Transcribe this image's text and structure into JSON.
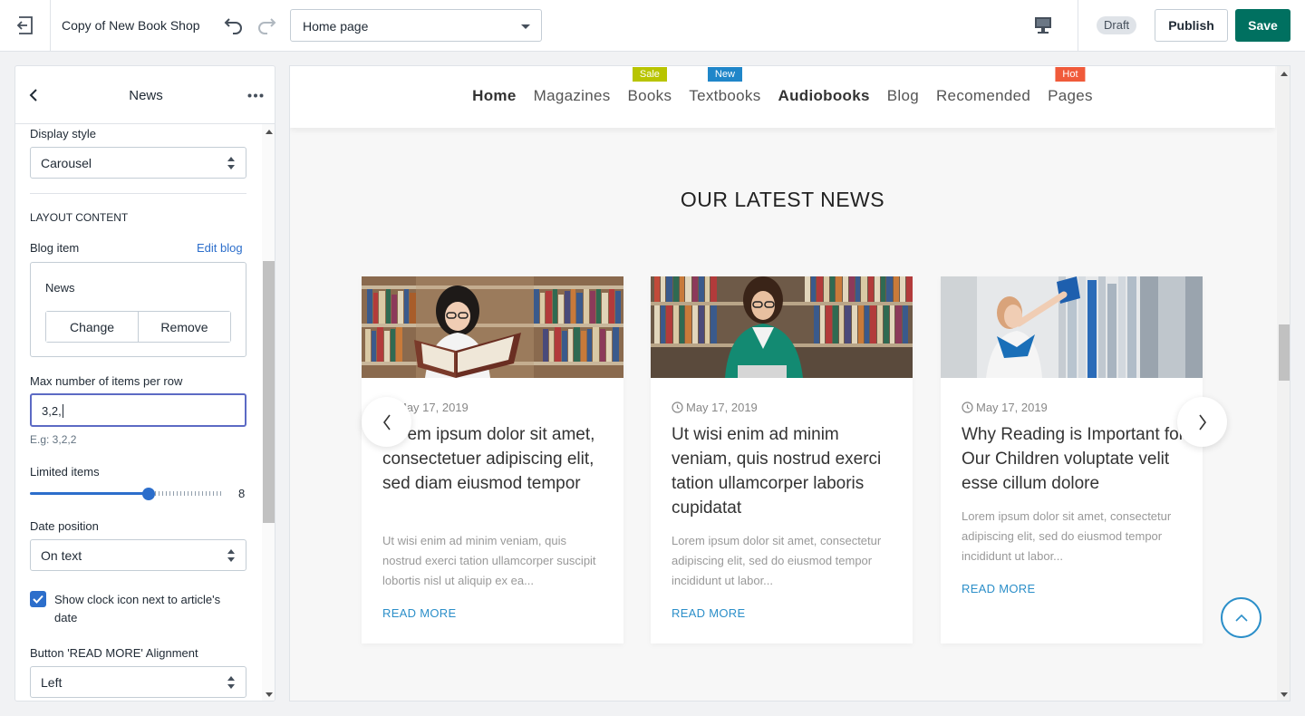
{
  "topbar": {
    "exit_icon": "exit-icon",
    "title": "Copy of New Book Shop",
    "page_select": "Home page",
    "status": "Draft",
    "publish_label": "Publish",
    "save_label": "Save",
    "accent": "#007060"
  },
  "panel": {
    "title": "News",
    "display_style": {
      "label": "Display style",
      "value": "Carousel"
    },
    "layout_heading": "LAYOUT CONTENT",
    "blog_item": {
      "label": "Blog item",
      "edit_link": "Edit blog",
      "selected": "News",
      "change_label": "Change",
      "remove_label": "Remove"
    },
    "max_items": {
      "label": "Max number of items per row",
      "value": "3,2,",
      "hint": "E.g: 3,2,2"
    },
    "limited_items": {
      "label": "Limited items",
      "value": "8",
      "fraction": 0.62
    },
    "date_position": {
      "label": "Date position",
      "value": "On text"
    },
    "show_clock": {
      "label": "Show clock icon next to article's date",
      "checked": true
    },
    "read_more_alignment": {
      "label": "Button 'READ MORE' Alignment",
      "value": "Left"
    }
  },
  "preview": {
    "nav": [
      {
        "label": "Home",
        "bold": true
      },
      {
        "label": "Magazines"
      },
      {
        "label": "Books",
        "badge": "Sale",
        "badge_color": "#b8c400"
      },
      {
        "label": "Textbooks",
        "badge": "New",
        "badge_color": "#1f86c9"
      },
      {
        "label": "Audiobooks",
        "bold": true
      },
      {
        "label": "Blog"
      },
      {
        "label": "Recomended"
      },
      {
        "label": "Pages",
        "badge": "Hot",
        "badge_color": "#f05a3a"
      }
    ],
    "section_title": "OUR LATEST NEWS",
    "cards": [
      {
        "date": "May 17, 2019",
        "title": "Lorem ipsum dolor sit amet, consectetuer adipiscing elit, sed diam eiusmod tempor",
        "excerpt": "Ut wisi enim ad minim veniam, quis nostrud exerci tation ullamcorper suscipit lobortis nisl ut aliquip ex ea...",
        "read_more": "READ MORE"
      },
      {
        "date": "May 17, 2019",
        "title": "Ut wisi enim ad minim veniam, quis nostrud exerci tation ullamcorper laboris cupidatat",
        "excerpt": "Lorem ipsum dolor sit amet, consectetur adipiscing elit, sed do eiusmod tempor incididunt ut labor...",
        "read_more": "READ MORE"
      },
      {
        "date": "May 17, 2019",
        "title": "Why Reading is Important for Our Children voluptate velit esse cillum dolore",
        "excerpt": "Lorem ipsum dolor sit amet, consectetur adipiscing elit, sed do eiusmod tempor incididunt ut labor...",
        "read_more": "READ MORE"
      }
    ]
  }
}
